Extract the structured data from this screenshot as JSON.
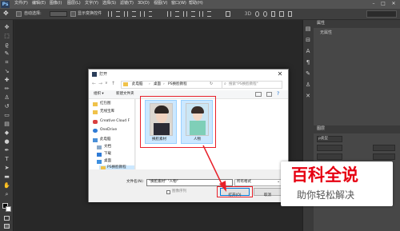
{
  "app": {
    "logo": "Ps",
    "menu": [
      "文件(F)",
      "编辑(E)",
      "图像(I)",
      "图层(L)",
      "文字(Y)",
      "选择(S)",
      "滤镜(T)",
      "3D(D)",
      "视图(V)",
      "窗口(W)",
      "帮助(H)"
    ],
    "window_controls": [
      "–",
      "□",
      "✕"
    ]
  },
  "options_bar": {
    "auto_select_label": "自动选择:",
    "show_transform_label": "显示变换控件"
  },
  "panels": {
    "properties_tab": "属性",
    "properties_label": "无属性",
    "layers_tab": "图层",
    "layers_kind": "ρ类型"
  },
  "dialog": {
    "title": "打开",
    "close": "✕",
    "path": [
      "此电脑",
      "桌面",
      "PS换脸教程"
    ],
    "search_placeholder": "搜索\"PS换脸教程\"",
    "organize": "组织 ▾",
    "new_folder": "新建文件夹",
    "nav_items": [
      {
        "label": "红包图",
        "icon": "folder-icon"
      },
      {
        "label": "无线宝库",
        "icon": "folder-icon"
      },
      {
        "label": "Creative Cloud F",
        "icon": "cloud-icon"
      },
      {
        "label": "OneDrive",
        "icon": "cloud-icon"
      },
      {
        "label": "此电脑",
        "icon": "computer-icon"
      },
      {
        "label": "文档",
        "icon": "document-icon"
      },
      {
        "label": "下载",
        "icon": "download-icon"
      },
      {
        "label": "桌面",
        "icon": "desktop-icon"
      },
      {
        "label": "PS换脸教程",
        "icon": "folder-icon"
      }
    ],
    "files": [
      {
        "label": "换脸素材"
      },
      {
        "label": "人物"
      }
    ],
    "filename_label": "文件名(N):",
    "filename_value": "\"换脸素材\" \"人物\"",
    "format_value": "所有格式",
    "image_sequence_label": "图像序列",
    "open_button": "打开(O)",
    "cancel_button": "取消"
  },
  "watermark": {
    "title": "百科全说",
    "subtitle": "助你轻松解决"
  },
  "colors": {
    "highlight": "#e8202a",
    "watermark_red": "#e60012",
    "ps_gray": "#535353"
  }
}
